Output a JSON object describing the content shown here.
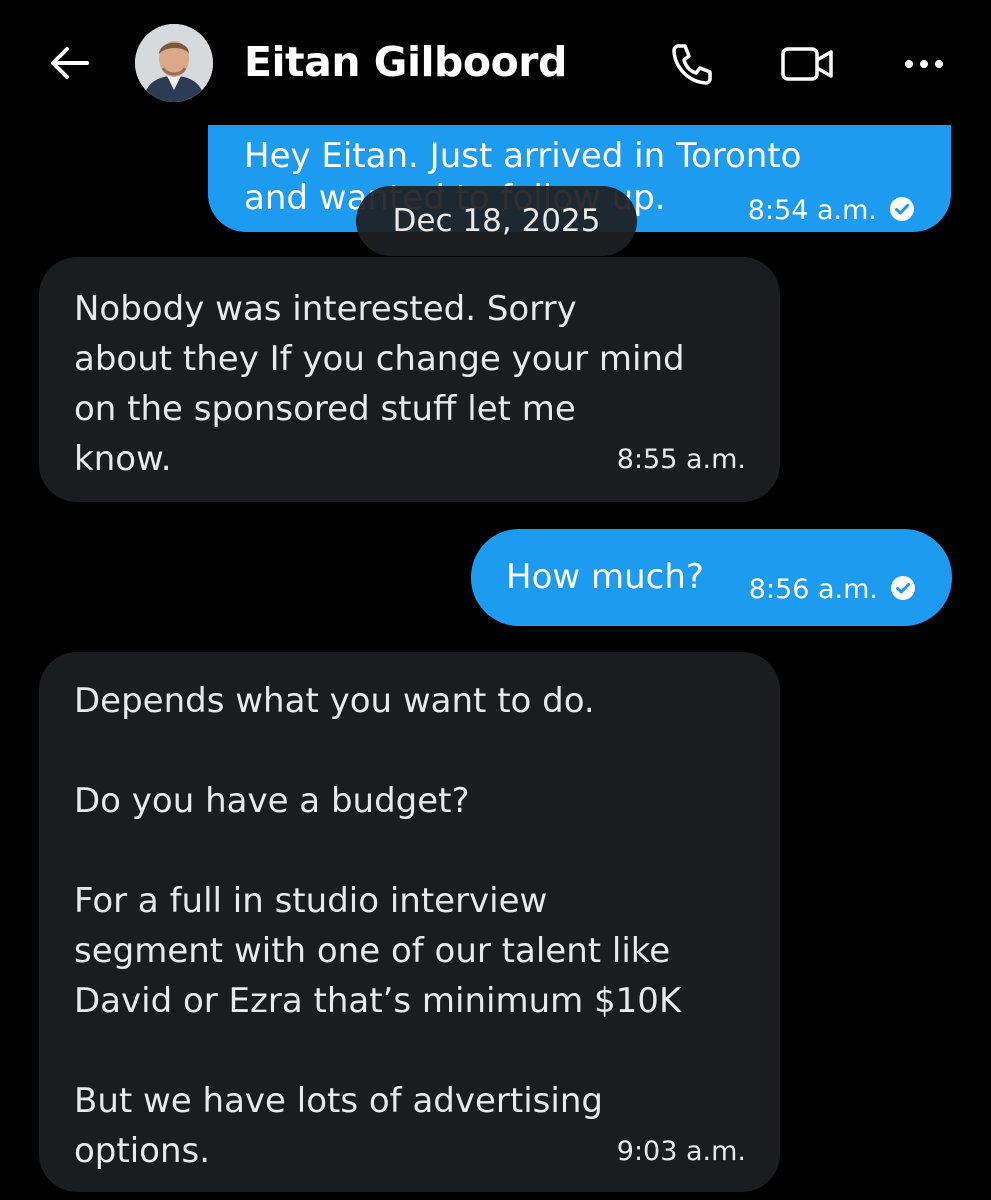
{
  "header": {
    "contact_name": "Eitan Gilboord",
    "back_icon": "arrow-left-icon",
    "call_icon": "phone-icon",
    "video_icon": "video-camera-icon",
    "more_icon": "more-dots-icon"
  },
  "date_separator": "Dec 18, 2025",
  "messages": [
    {
      "direction": "sent",
      "line1": "Hey Eitan. Just arrived in Toronto",
      "line2": "and wanted to follow up.",
      "time": "8:54 a.m.",
      "status": "read"
    },
    {
      "direction": "received",
      "text": "Nobody was interested. Sorry\nabout they If you change your mind\non the sponsored stuff let me\nknow.",
      "time": "8:55 a.m."
    },
    {
      "direction": "sent",
      "text": "How much?",
      "time": "8:56 a.m.",
      "status": "read"
    },
    {
      "direction": "received",
      "text": "Depends what you want to do.\n\nDo you have a budget?\n\nFor a full in studio interview\nsegment with one of our talent like\nDavid or Ezra that’s minimum $10K\n\nBut we have lots of advertising\noptions.",
      "time": "9:03 a.m."
    }
  ],
  "colors": {
    "background": "#000000",
    "sent_bubble": "#1d9bf0",
    "received_bubble": "#1b1c1e",
    "text": "#e7e9ea"
  }
}
